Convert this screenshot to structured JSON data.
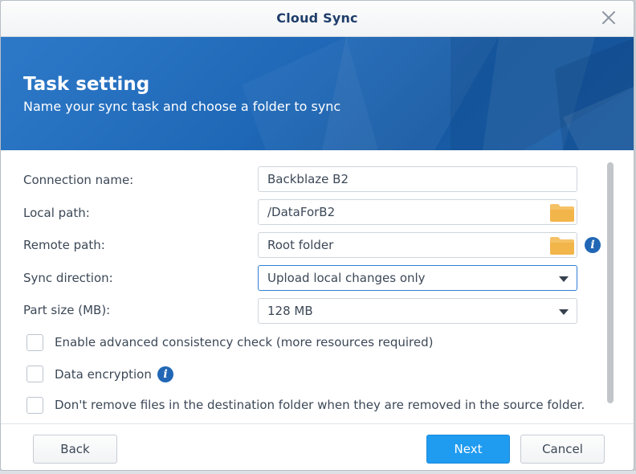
{
  "window": {
    "title": "Cloud Sync"
  },
  "banner": {
    "heading": "Task setting",
    "subheading": "Name your sync task and choose a folder to sync"
  },
  "form": {
    "connection_name": {
      "label": "Connection name:",
      "value": "Backblaze B2"
    },
    "local_path": {
      "label": "Local path:",
      "value": "/DataForB2",
      "icon": "folder-icon"
    },
    "remote_path": {
      "label": "Remote path:",
      "value": "Root folder",
      "icon": "folder-icon",
      "info_icon": "info-icon"
    },
    "sync_direction": {
      "label": "Sync direction:",
      "value": "Upload local changes only"
    },
    "part_size": {
      "label": "Part size (MB):",
      "value": "128 MB"
    }
  },
  "options": [
    {
      "label": "Enable advanced consistency check (more resources required)",
      "checked": false
    },
    {
      "label": "Data encryption",
      "checked": false,
      "info_icon": "info-icon"
    },
    {
      "label": "Don't remove files in the destination folder when they are removed in the source folder.",
      "checked": false
    }
  ],
  "footer": {
    "back_label": "Back",
    "next_label": "Next",
    "cancel_label": "Cancel"
  },
  "colors": {
    "accent": "#1f9bf0",
    "banner": "#1f68b7",
    "folder": "#f5c165",
    "info": "#2167b5"
  }
}
